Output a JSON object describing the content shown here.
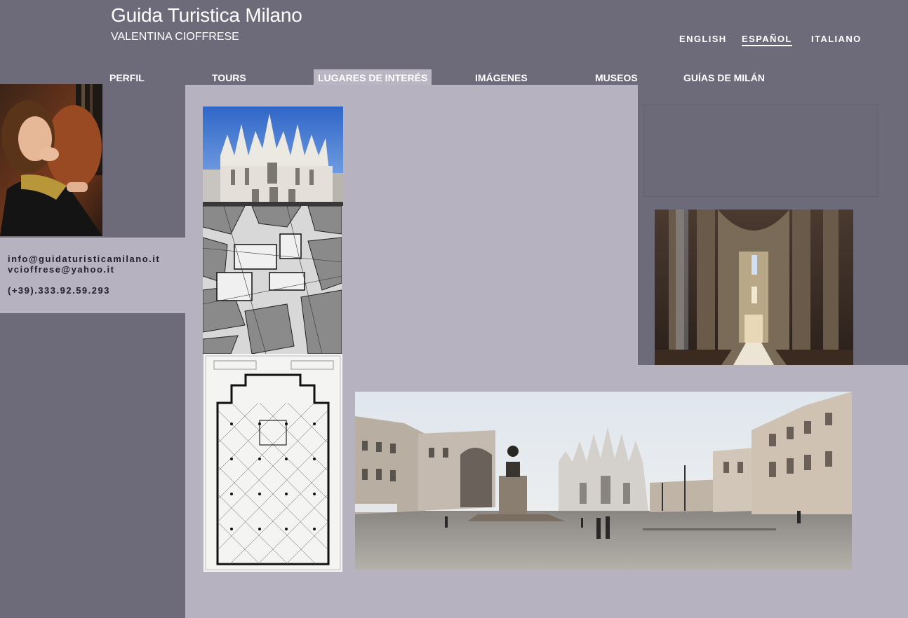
{
  "header": {
    "title": "Guida Turistica Milano",
    "subtitle": "VALENTINA CIOFFRESE"
  },
  "languages": [
    {
      "label": "ENGLISH",
      "active": false
    },
    {
      "label": "ESPAÑOL",
      "active": true
    },
    {
      "label": "ITALIANO",
      "active": false
    }
  ],
  "nav": [
    {
      "label": "PERFIL"
    },
    {
      "label": "TOURS"
    },
    {
      "label": "LUGARES DE INTERÉS",
      "active": true
    },
    {
      "label": "IMÁGENES"
    },
    {
      "label": "MUSEOS"
    },
    {
      "label": "GUÍAS DE MILÁN"
    }
  ],
  "contact": {
    "email1": "info@guidaturisticamilano.it",
    "email2": "vcioffrese@yahoo.it",
    "phone": "(+39).333.92.59.293"
  },
  "images": {
    "portrait": "guide-portrait-photo",
    "duomo": "duomo-facade-photo",
    "map": "historic-map-engraving",
    "plan": "cathedral-floor-plan",
    "interior": "cathedral-interior-photo",
    "piazza": "piazza-duomo-panorama"
  },
  "colors": {
    "background": "#6d6a7a",
    "panel": "#b6b2c0",
    "text": "#ffffff"
  }
}
